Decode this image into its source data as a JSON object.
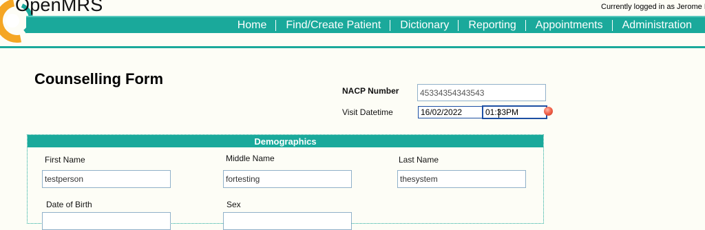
{
  "header": {
    "app_title": "OpenMRS",
    "login_status": "Currently logged in as Jerome I",
    "nav": [
      "Home",
      "Find/Create Patient",
      "Dictionary",
      "Reporting",
      "Appointments",
      "Administration"
    ],
    "colors": {
      "nav_bg": "#1aa99b",
      "logo_orange": "#f5a623",
      "logo_teal": "#1aa99b"
    }
  },
  "form": {
    "title": "Counselling Form",
    "nacp_label": "NACP Number",
    "nacp_value": "45334354343543",
    "visit_label": "Visit Datetime",
    "visit_date": "16/02/2022",
    "visit_time": "01:33PM"
  },
  "demographics": {
    "header": "Demographics",
    "first_name_label": "First Name",
    "first_name_value": "testperson",
    "middle_name_label": "Middle Name",
    "middle_name_value": "fortesting",
    "last_name_label": "Last Name",
    "last_name_value": "thesystem",
    "dob_label": "Date of Birth",
    "sex_label": "Sex"
  }
}
